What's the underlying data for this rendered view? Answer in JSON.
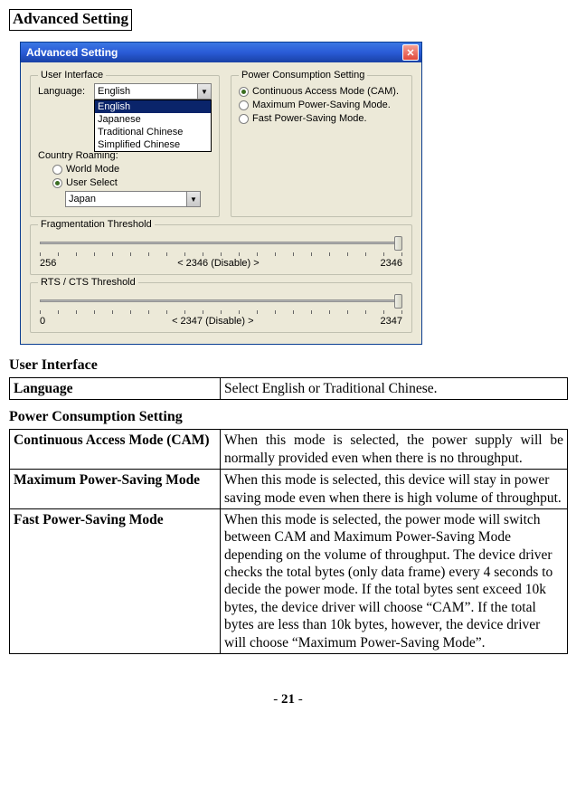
{
  "page": {
    "title": "Advanced Setting",
    "footer_prefix": "- ",
    "footer_page": "21",
    "footer_suffix": " -"
  },
  "dialog": {
    "title": "Advanced Setting",
    "panels": {
      "user_interface": {
        "legend": "User Interface",
        "language_label": "Language:",
        "language_value": "English",
        "language_options": [
          "English",
          "Japanese",
          "Traditional Chinese",
          "Simplified Chinese"
        ],
        "roaming_label": "Country Roaming:",
        "roaming_world": "World Mode",
        "roaming_user": "User Select",
        "roaming_selected": "User",
        "country_value": "Japan"
      },
      "power": {
        "legend": "Power Consumption Setting",
        "options": [
          "Continuous Access Mode (CAM).",
          "Maximum Power-Saving Mode.",
          "Fast Power-Saving Mode."
        ],
        "selected": 0
      },
      "frag": {
        "legend": "Fragmentation Threshold",
        "min": "256",
        "center": "< 2346 (Disable) >",
        "max": "2346"
      },
      "rts": {
        "legend": "RTS / CTS Threshold",
        "min": "0",
        "center": "< 2347 (Disable) >",
        "max": "2347"
      }
    }
  },
  "sections": {
    "ui_heading": "User Interface",
    "power_heading": "Power Consumption Setting",
    "ui_table": [
      {
        "key": "Language",
        "val": "Select English or Traditional Chinese."
      }
    ],
    "power_table": [
      {
        "key": "Continuous Access Mode (CAM)",
        "val": "When this mode is selected, the power supply will be normally provided even when there is no throughput."
      },
      {
        "key": "Maximum Power-Saving Mode",
        "val": "When this mode is selected, this device will stay in power saving mode even when there is high volume of throughput."
      },
      {
        "key": "Fast Power-Saving Mode",
        "val": "When this mode is selected, the power mode will switch between CAM and Maximum Power-Saving Mode depending on the volume of throughput. The device driver checks the total bytes (only data frame) every 4 seconds to decide the power mode. If the total bytes sent exceed 10k bytes, the device driver will choose “CAM”. If the total bytes are less than 10k bytes, however, the device driver will choose “Maximum Power-Saving Mode”."
      }
    ]
  }
}
